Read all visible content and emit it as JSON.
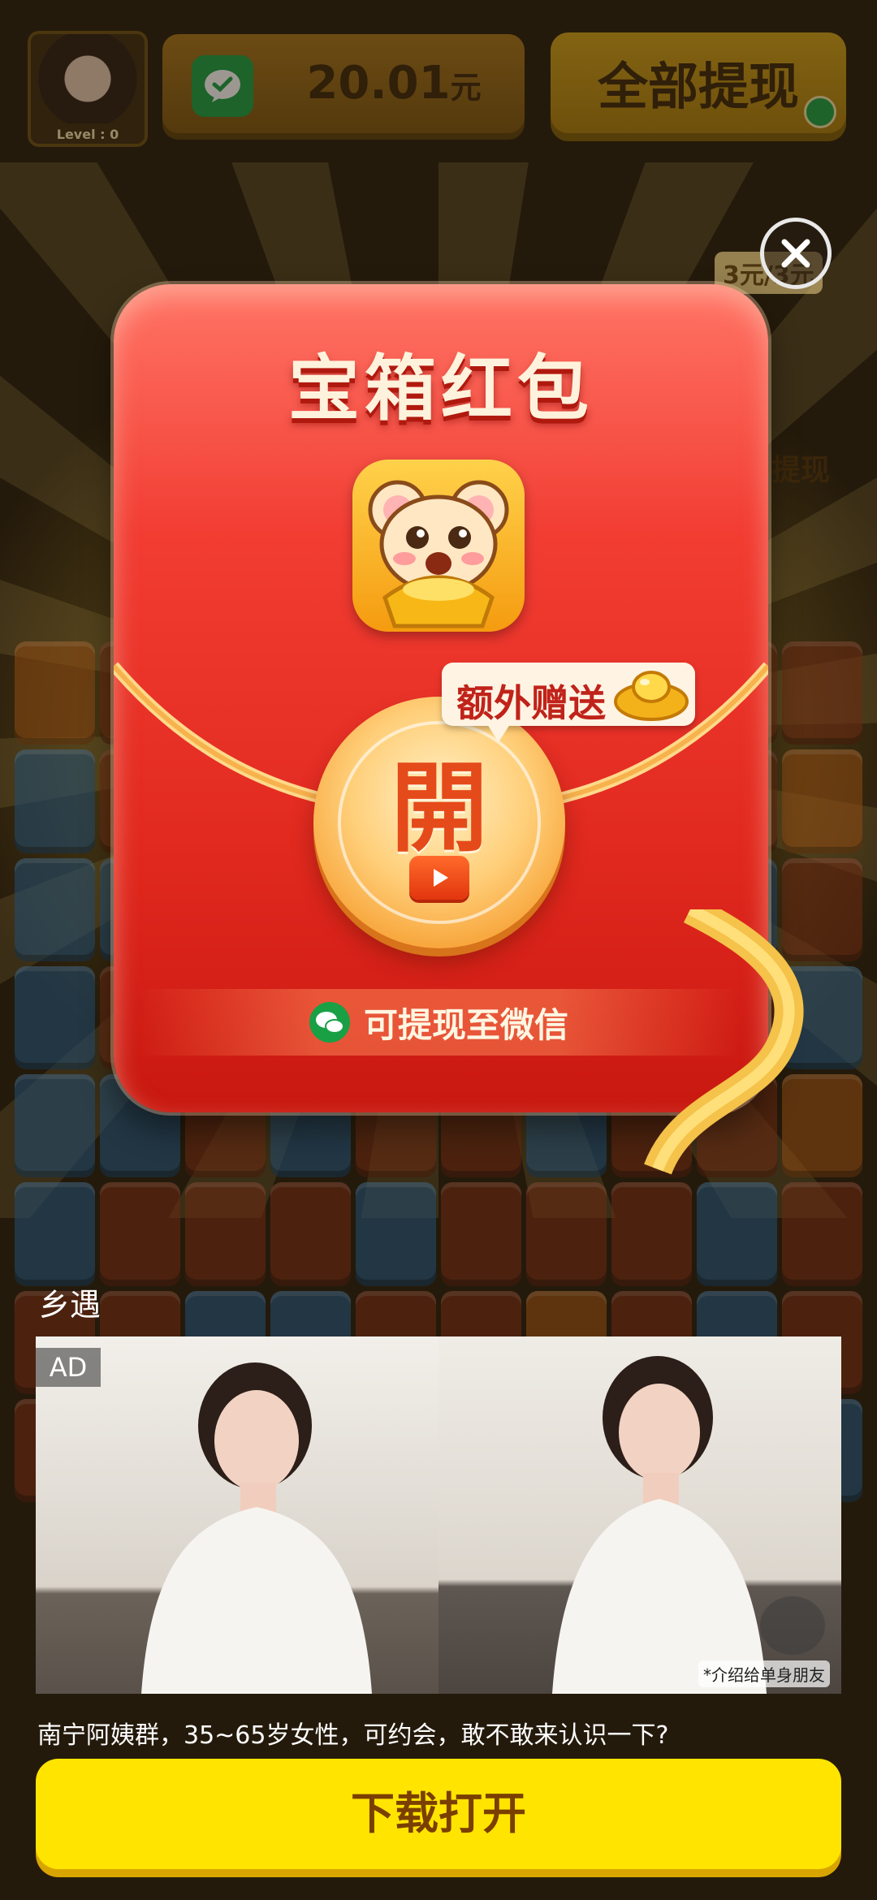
{
  "hud": {
    "level_label": "Level : 0",
    "balance_amount": "20.01",
    "balance_unit": "元",
    "withdraw_all_label": "全部提现"
  },
  "side_prize": {
    "amount_text": "3元/3元",
    "label": "提现"
  },
  "popup": {
    "title": "宝箱红包",
    "open_glyph": "開",
    "bonus_text": "额外赠送",
    "withdraw_hint": "可提现至微信"
  },
  "ad": {
    "brand": "乡遇",
    "badge": "AD",
    "image_caption": "*介绍给单身朋友",
    "description": "南宁阿姨群，35~65岁女性，可约会，敢不敢来认识一下?",
    "cta_label": "下载打开"
  },
  "colors": {
    "envelope_red": "#e0281e",
    "cta_yellow": "#ffe400",
    "wechat_green": "#19a045"
  }
}
